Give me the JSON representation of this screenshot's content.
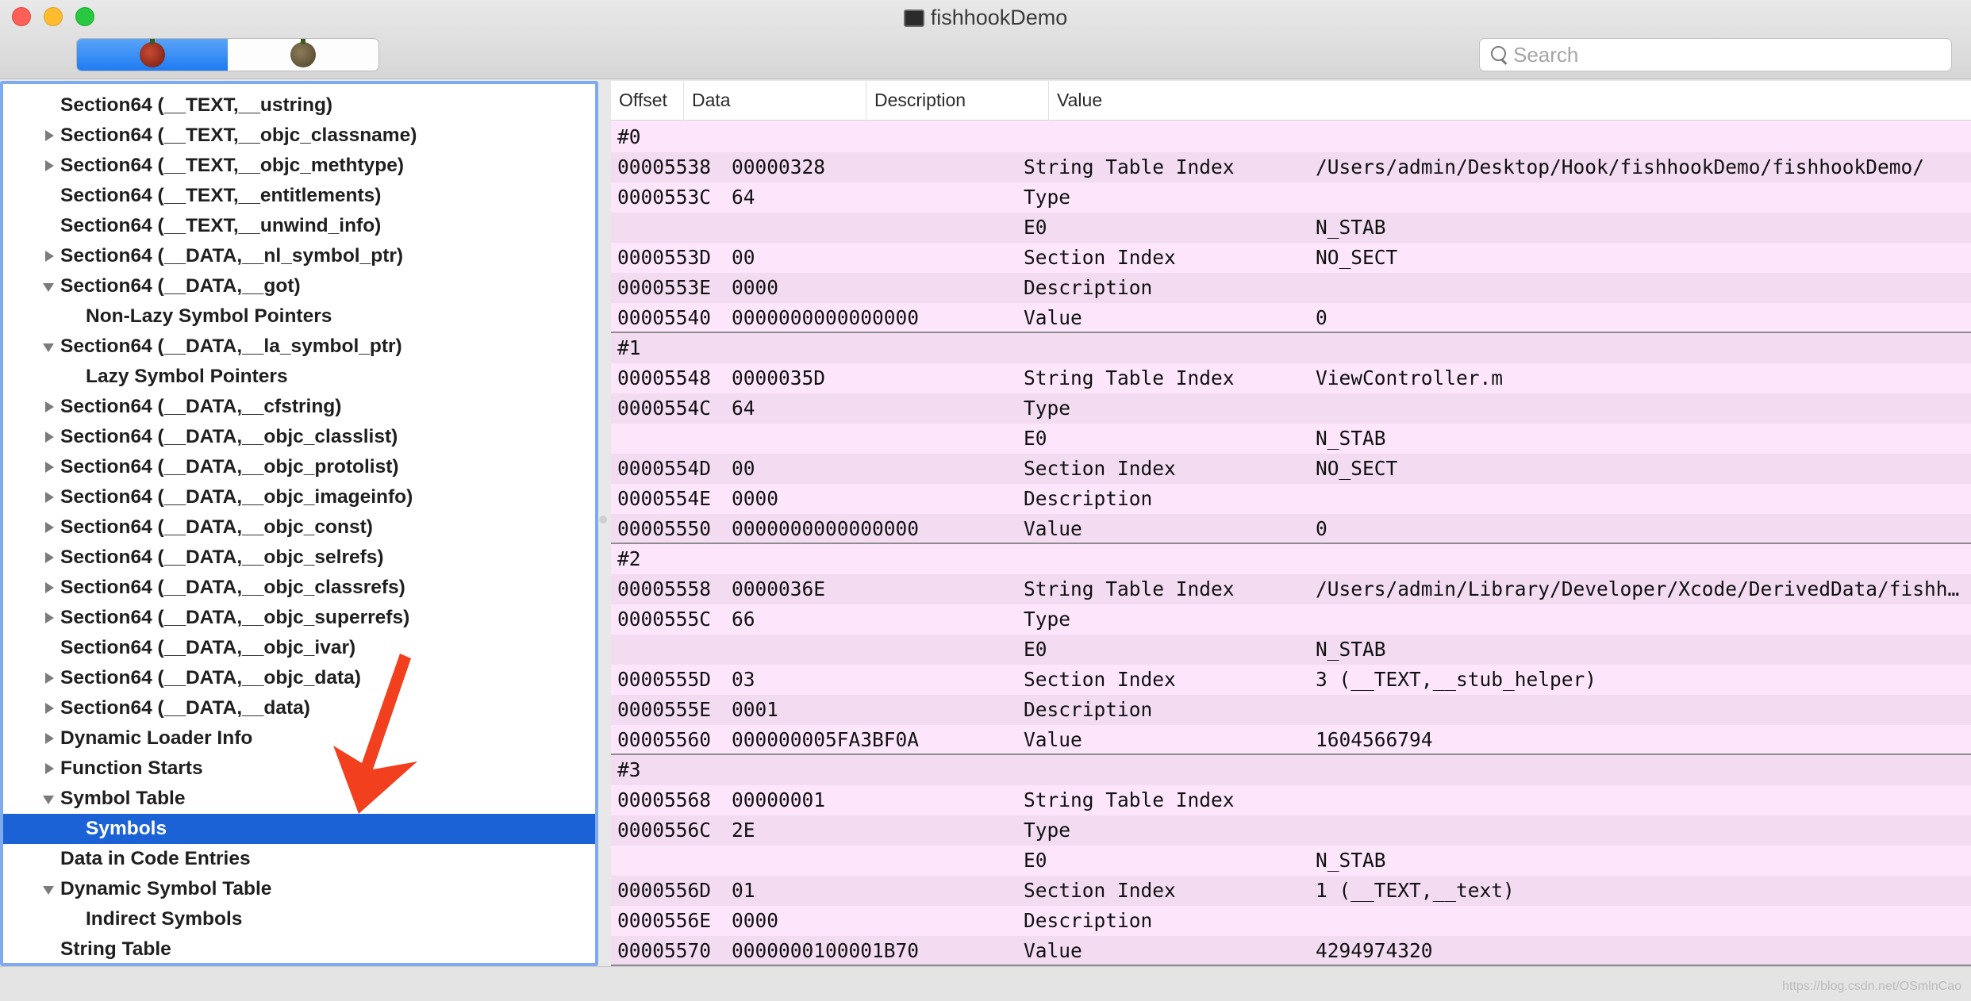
{
  "window": {
    "title": "fishhookDemo"
  },
  "toolbar": {
    "segments": [
      {
        "icon": "bug-icon-color",
        "active": true
      },
      {
        "icon": "bug-icon-gray",
        "active": false
      }
    ],
    "search_placeholder": "Search"
  },
  "sidebar": {
    "items": [
      {
        "label": "Section64 (__TEXT,__ustring)",
        "level": 0,
        "disclosure": "none"
      },
      {
        "label": "Section64 (__TEXT,__objc_classname)",
        "level": 0,
        "disclosure": "closed"
      },
      {
        "label": "Section64 (__TEXT,__objc_methtype)",
        "level": 0,
        "disclosure": "closed"
      },
      {
        "label": "Section64 (__TEXT,__entitlements)",
        "level": 0,
        "disclosure": "none"
      },
      {
        "label": "Section64 (__TEXT,__unwind_info)",
        "level": 0,
        "disclosure": "none"
      },
      {
        "label": "Section64 (__DATA,__nl_symbol_ptr)",
        "level": 0,
        "disclosure": "closed"
      },
      {
        "label": "Section64 (__DATA,__got)",
        "level": 0,
        "disclosure": "open"
      },
      {
        "label": "Non-Lazy Symbol Pointers",
        "level": 1,
        "disclosure": "none"
      },
      {
        "label": "Section64 (__DATA,__la_symbol_ptr)",
        "level": 0,
        "disclosure": "open"
      },
      {
        "label": "Lazy Symbol Pointers",
        "level": 1,
        "disclosure": "none"
      },
      {
        "label": "Section64 (__DATA,__cfstring)",
        "level": 0,
        "disclosure": "closed"
      },
      {
        "label": "Section64 (__DATA,__objc_classlist)",
        "level": 0,
        "disclosure": "closed"
      },
      {
        "label": "Section64 (__DATA,__objc_protolist)",
        "level": 0,
        "disclosure": "closed"
      },
      {
        "label": "Section64 (__DATA,__objc_imageinfo)",
        "level": 0,
        "disclosure": "closed"
      },
      {
        "label": "Section64 (__DATA,__objc_const)",
        "level": 0,
        "disclosure": "closed"
      },
      {
        "label": "Section64 (__DATA,__objc_selrefs)",
        "level": 0,
        "disclosure": "closed"
      },
      {
        "label": "Section64 (__DATA,__objc_classrefs)",
        "level": 0,
        "disclosure": "closed"
      },
      {
        "label": "Section64 (__DATA,__objc_superrefs)",
        "level": 0,
        "disclosure": "closed"
      },
      {
        "label": "Section64 (__DATA,__objc_ivar)",
        "level": 0,
        "disclosure": "none"
      },
      {
        "label": "Section64 (__DATA,__objc_data)",
        "level": 0,
        "disclosure": "closed"
      },
      {
        "label": "Section64 (__DATA,__data)",
        "level": 0,
        "disclosure": "closed"
      },
      {
        "label": "Dynamic Loader Info",
        "level": 0,
        "disclosure": "closed"
      },
      {
        "label": "Function Starts",
        "level": 0,
        "disclosure": "closed"
      },
      {
        "label": "Symbol Table",
        "level": 0,
        "disclosure": "open"
      },
      {
        "label": "Symbols",
        "level": 1,
        "disclosure": "none",
        "selected": true
      },
      {
        "label": "Data in Code Entries",
        "level": 0,
        "disclosure": "none"
      },
      {
        "label": "Dynamic Symbol Table",
        "level": 0,
        "disclosure": "open"
      },
      {
        "label": "Indirect Symbols",
        "level": 1,
        "disclosure": "none"
      },
      {
        "label": "String Table",
        "level": 0,
        "disclosure": "none"
      }
    ]
  },
  "table": {
    "columns": [
      "Offset",
      "Data",
      "Description",
      "Value"
    ],
    "groups": [
      {
        "header": "#0",
        "rows": [
          [
            "00005538",
            "00000328",
            "String Table Index",
            "/Users/admin/Desktop/Hook/fishhookDemo/fishhookDemo/"
          ],
          [
            "0000553C",
            "64",
            "Type",
            ""
          ],
          [
            "",
            "",
            "E0",
            "N_STAB"
          ],
          [
            "0000553D",
            "00",
            "Section Index",
            "NO_SECT"
          ],
          [
            "0000553E",
            "0000",
            "Description",
            ""
          ],
          [
            "00005540",
            "0000000000000000",
            "Value",
            "0"
          ]
        ]
      },
      {
        "header": "#1",
        "rows": [
          [
            "00005548",
            "0000035D",
            "String Table Index",
            "ViewController.m"
          ],
          [
            "0000554C",
            "64",
            "Type",
            ""
          ],
          [
            "",
            "",
            "E0",
            "N_STAB"
          ],
          [
            "0000554D",
            "00",
            "Section Index",
            "NO_SECT"
          ],
          [
            "0000554E",
            "0000",
            "Description",
            ""
          ],
          [
            "00005550",
            "0000000000000000",
            "Value",
            "0"
          ]
        ]
      },
      {
        "header": "#2",
        "rows": [
          [
            "00005558",
            "0000036E",
            "String Table Index",
            "/Users/admin/Library/Developer/Xcode/DerivedData/fishho…"
          ],
          [
            "0000555C",
            "66",
            "Type",
            ""
          ],
          [
            "",
            "",
            "E0",
            "N_STAB"
          ],
          [
            "0000555D",
            "03",
            "Section Index",
            "3 (__TEXT,__stub_helper)"
          ],
          [
            "0000555E",
            "0001",
            "Description",
            ""
          ],
          [
            "00005560",
            "000000005FA3BF0A",
            "Value",
            "1604566794"
          ]
        ]
      },
      {
        "header": "#3",
        "rows": [
          [
            "00005568",
            "00000001",
            "String Table Index",
            ""
          ],
          [
            "0000556C",
            "2E",
            "Type",
            ""
          ],
          [
            "",
            "",
            "E0",
            "N_STAB"
          ],
          [
            "0000556D",
            "01",
            "Section Index",
            "1 (__TEXT,__text)"
          ],
          [
            "0000556E",
            "0000",
            "Description",
            ""
          ],
          [
            "00005570",
            "0000000100001B70",
            "Value",
            "4294974320"
          ]
        ]
      }
    ]
  },
  "footer": {
    "watermark": "https://blog.csdn.net/OSmlnCao"
  },
  "colors": {
    "selection": "#1a62d6",
    "row_pink": "#fde6fc",
    "row_pink_alt": "#f3dcf2",
    "arrow": "#f2401f",
    "segment_active": "#1e7cf2"
  }
}
